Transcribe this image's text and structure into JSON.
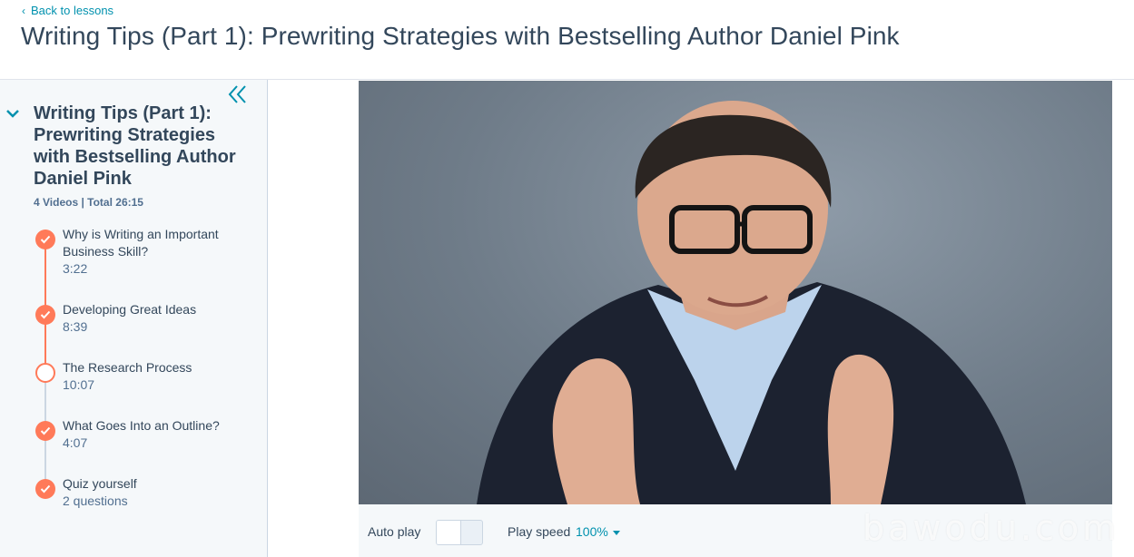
{
  "header": {
    "back_link": "Back to lessons",
    "title": "Writing Tips (Part 1): Prewriting Strategies with Bestselling Author Daniel Pink"
  },
  "sidebar": {
    "collapse_icon": "double-chevron-left-icon",
    "section": {
      "title": "Writing Tips (Part 1): Prewriting Strategies with Bestselling Author Daniel Pink",
      "meta": "4 Videos | Total 26:15"
    },
    "lessons": [
      {
        "title": "Why is Writing an Important Business Skill?",
        "subtitle": "3:22",
        "status": "completed"
      },
      {
        "title": "Developing Great Ideas",
        "subtitle": "8:39",
        "status": "completed"
      },
      {
        "title": "The Research Process",
        "subtitle": "10:07",
        "status": "current"
      },
      {
        "title": "What Goes Into an Outline?",
        "subtitle": "4:07",
        "status": "completed"
      },
      {
        "title": "Quiz yourself",
        "subtitle": "2 questions",
        "status": "completed"
      }
    ]
  },
  "controls": {
    "autoplay_label": "Auto play",
    "autoplay_on": false,
    "speed_label": "Play speed",
    "speed_value": "100%"
  },
  "watermark": "bawodu.com",
  "colors": {
    "accent": "#ff7a59",
    "link": "#0091ae",
    "text": "#33475b",
    "sidebar_bg": "#f5f8fa"
  }
}
